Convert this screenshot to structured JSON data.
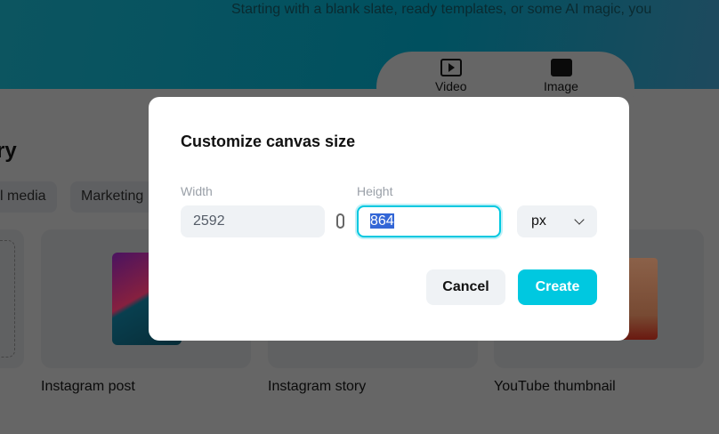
{
  "banner": {
    "tagline": "Starting with a blank slate, ready templates, or some AI magic, you",
    "tabs": [
      {
        "label": "Video",
        "icon": "video-icon"
      },
      {
        "label": "Image",
        "icon": "image-icon"
      }
    ]
  },
  "section": {
    "heading": "ry",
    "chips": [
      "l media",
      "Marketing"
    ],
    "cards": [
      {
        "label": "Instagram post"
      },
      {
        "label": "Instagram story"
      },
      {
        "label": "YouTube thumbnail"
      }
    ]
  },
  "dialog": {
    "title": "Customize canvas size",
    "width_label": "Width",
    "width_value": "2592",
    "height_label": "Height",
    "height_value": "864",
    "unit": "px",
    "cancel": "Cancel",
    "create": "Create"
  },
  "colors": {
    "accent": "#00c8e0"
  }
}
